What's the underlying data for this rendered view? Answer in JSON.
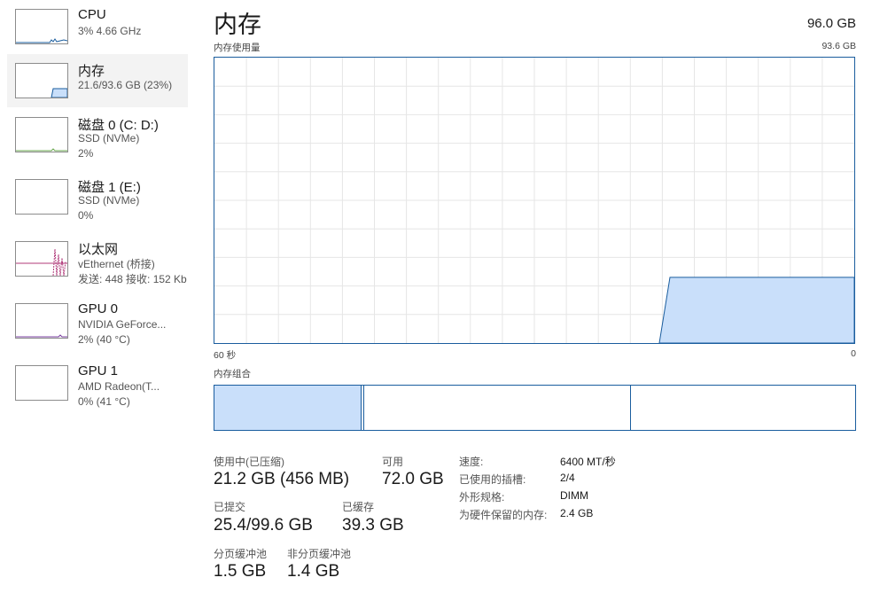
{
  "colors": {
    "accent": "#1a5d9e",
    "fill": "#c9dffa",
    "grid": "#e6e6e6",
    "ethernet_line": "#b03a7a"
  },
  "sidebar": {
    "items": [
      {
        "title": "CPU",
        "sub1": "3% 4.66 GHz",
        "sub2": ""
      },
      {
        "title": "内存",
        "sub1": "21.6/93.6 GB (23%)",
        "sub2": ""
      },
      {
        "title": "磁盘 0 (C: D:)",
        "sub1": "SSD (NVMe)",
        "sub2": "2%"
      },
      {
        "title": "磁盘 1 (E:)",
        "sub1": "SSD (NVMe)",
        "sub2": "0%"
      },
      {
        "title": "以太网",
        "sub1": "vEthernet (桥接)",
        "sub2": "发送: 448 接收: 152 Kb"
      },
      {
        "title": "GPU 0",
        "sub1": "NVIDIA GeForce...",
        "sub2": "2% (40 °C)"
      },
      {
        "title": "GPU 1",
        "sub1": "AMD Radeon(T...",
        "sub2": "0% (41 °C)"
      }
    ]
  },
  "main": {
    "title": "内存",
    "total": "96.0 GB",
    "usage_label": "内存使用量",
    "usage_max": "93.6 GB",
    "time_start": "60 秒",
    "time_end": "0",
    "composition_label": "内存组合",
    "usage_fraction": 0.23,
    "stats": {
      "in_use_label": "使用中(已压缩)",
      "in_use_value": "21.2 GB (456 MB)",
      "available_label": "可用",
      "available_value": "72.0 GB",
      "committed_label": "已提交",
      "committed_value": "25.4/99.6 GB",
      "cached_label": "已缓存",
      "cached_value": "39.3 GB",
      "paged_label": "分页缓冲池",
      "paged_value": "1.5 GB",
      "nonpaged_label": "非分页缓冲池",
      "nonpaged_value": "1.4 GB"
    },
    "details": [
      {
        "label": "速度:",
        "value": "6400 MT/秒"
      },
      {
        "label": "已使用的插槽:",
        "value": "2/4"
      },
      {
        "label": "外形规格:",
        "value": "DIMM"
      },
      {
        "label": "为硬件保留的内存:",
        "value": "2.4 GB"
      }
    ]
  }
}
